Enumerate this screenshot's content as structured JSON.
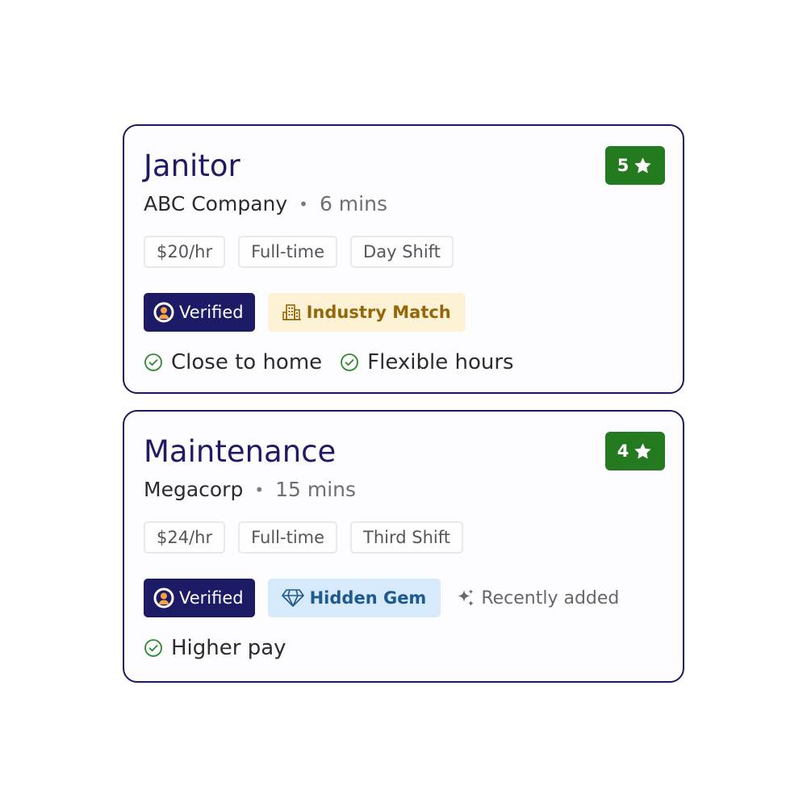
{
  "colors": {
    "title": "#1e1a66",
    "card_border": "#1b1a5c",
    "rating_bg": "#237a1f",
    "verified_bg": "#1e1b66",
    "industry_bg": "#fdf2d6",
    "industry_fg": "#94680a",
    "gem_bg": "#d6eafc",
    "gem_fg": "#1f5a8f",
    "check": "#2d8a2d"
  },
  "jobs": [
    {
      "title": "Janitor",
      "rating": "5",
      "rating_icon": "star-icon",
      "company": "ABC Company",
      "separator": "•",
      "distance": "6 mins",
      "tags": [
        "$20/hr",
        "Full-time",
        "Day Shift"
      ],
      "badges": {
        "verified": "Verified",
        "verified_icon": "verified-person-icon",
        "secondary": "Industry Match",
        "secondary_icon": "building-icon"
      },
      "perks": [
        "Close to home",
        "Flexible hours"
      ],
      "perk_icon": "check-circle-icon"
    },
    {
      "title": "Maintenance",
      "rating": "4",
      "rating_icon": "star-icon",
      "company": "Megacorp",
      "separator": "•",
      "distance": "15 mins",
      "tags": [
        "$24/hr",
        "Full-time",
        "Third Shift"
      ],
      "badges": {
        "verified": "Verified",
        "verified_icon": "verified-person-icon",
        "secondary": "Hidden Gem",
        "secondary_icon": "diamond-icon",
        "extra": "Recently added",
        "extra_icon": "sparkle-icon"
      },
      "perks": [
        "Higher pay"
      ],
      "perk_icon": "check-circle-icon"
    }
  ]
}
